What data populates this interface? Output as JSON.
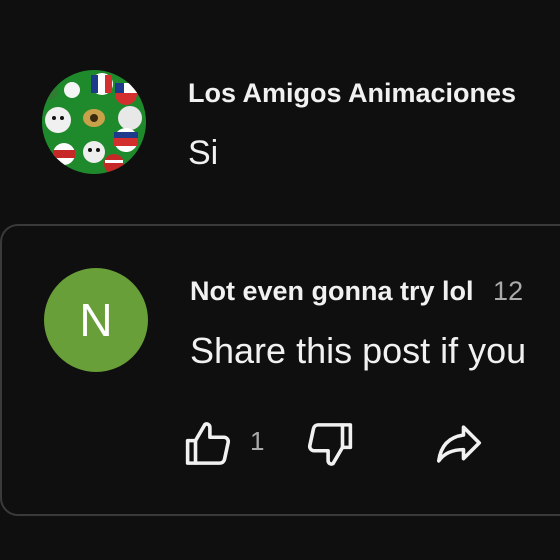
{
  "reply": {
    "author": "Los Amigos Animaciones",
    "text": "Si",
    "avatar_icon": "countryballs-avatar"
  },
  "comment": {
    "avatar_letter": "N",
    "avatar_color": "#689f38",
    "author": "Not even gonna try lol",
    "time": "12",
    "text": "Share this post if you",
    "like_count": "1",
    "actions": {
      "like_icon": "thumbs-up-icon",
      "dislike_icon": "thumbs-down-icon",
      "share_icon": "share-icon"
    }
  },
  "colors": {
    "background": "#0f0f0f",
    "card_border": "#3a3a3a",
    "text_primary": "#f1f1f1",
    "text_secondary": "#aaaaaa"
  }
}
